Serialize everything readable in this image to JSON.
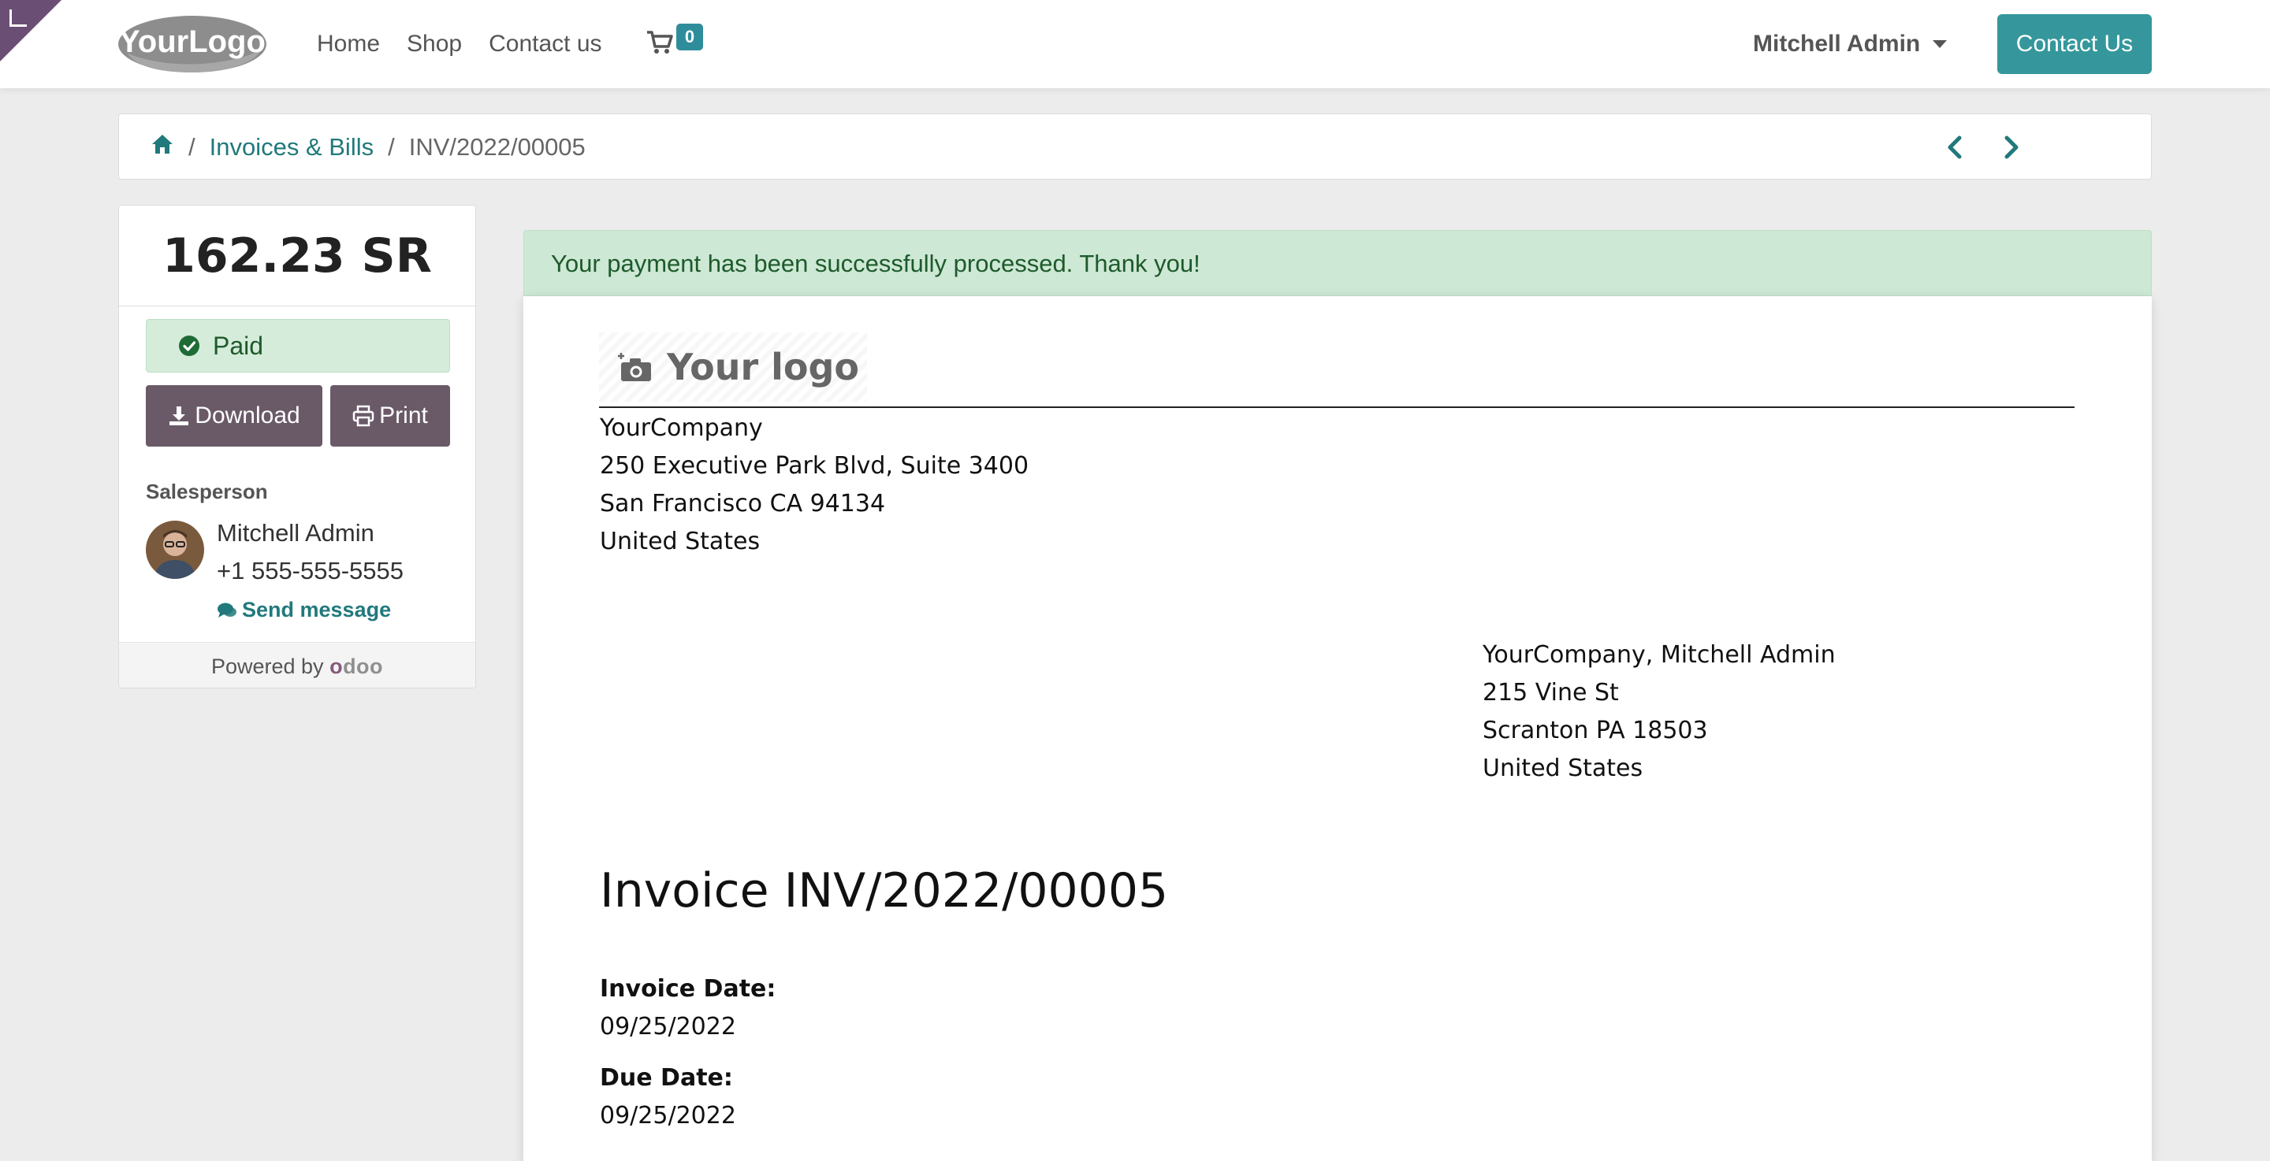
{
  "navbar": {
    "brand_logo_label": "YourLogo",
    "links": [
      "Home",
      "Shop",
      "Contact us"
    ],
    "cart_count": "0",
    "user_name": "Mitchell Admin",
    "contact_button": "Contact Us"
  },
  "breadcrumb": {
    "separator": "/",
    "items": [
      "Invoices & Bills",
      "INV/2022/00005"
    ]
  },
  "sidebar": {
    "amount": "162.23 SR",
    "status": "Paid",
    "download_label": "Download",
    "print_label": "Print",
    "salesperson_label": "Salesperson",
    "salesperson_name": "Mitchell Admin",
    "salesperson_phone": "+1 555-555-5555",
    "send_message": "Send message",
    "powered_by": "Powered by",
    "powered_brand": "odoo"
  },
  "alert": {
    "message": "Your payment has been successfully processed. Thank you!"
  },
  "invoice": {
    "logo_placeholder": "Your logo",
    "company_address": [
      "YourCompany",
      "250 Executive Park Blvd, Suite 3400",
      "San Francisco CA 94134",
      "United States"
    ],
    "partner_address": [
      "YourCompany, Mitchell Admin",
      "215 Vine St",
      "Scranton PA 18503",
      "United States"
    ],
    "title": "Invoice INV/2022/00005",
    "invoice_date_label": "Invoice Date:",
    "invoice_date": "09/25/2022",
    "due_date_label": "Due Date:",
    "due_date": "09/25/2022"
  },
  "colors": {
    "accent": "#35979c",
    "link": "#21797c",
    "dark_button": "#6a5a68",
    "success_bg": "#cde8d4",
    "brand_purple": "#6b4e74"
  },
  "icons": {
    "cart": "shopping-cart-icon",
    "home": "home-icon",
    "prev": "chevron-left-icon",
    "next": "chevron-right-icon",
    "check": "check-circle-icon",
    "download": "download-icon",
    "print": "print-icon",
    "chat": "comments-icon",
    "camera": "camera-plus-icon"
  }
}
